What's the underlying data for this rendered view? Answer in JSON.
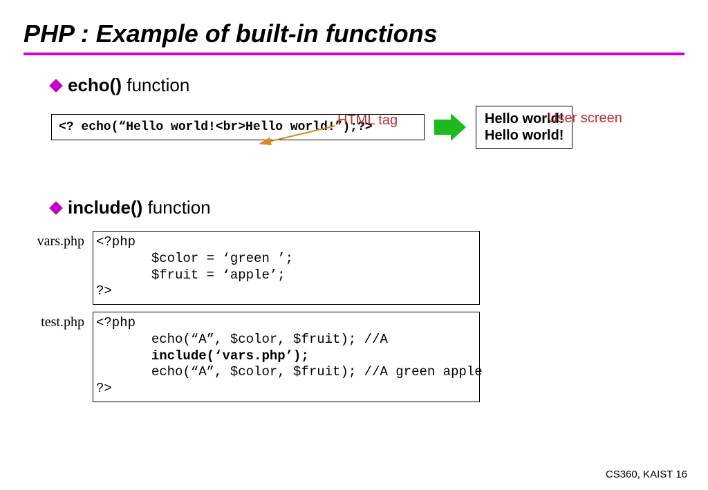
{
  "title": "PHP : Example of built-in functions",
  "section1": {
    "bullet_bold": "echo()",
    "bullet_rest": " function",
    "html_tag_label": "HTML tag",
    "user_screen_label": "User screen",
    "code": "<? echo(“Hello world!<br>Hello world!”);?>",
    "output_line1": "Hello world!",
    "output_line2": "Hello world!"
  },
  "section2": {
    "bullet_bold": "include()",
    "bullet_rest": " function",
    "files": [
      {
        "name": "vars.php",
        "code": "<?php\n       $color = ‘green ’;\n       $fruit = ‘apple’;\n?>"
      },
      {
        "name": "test.php",
        "code": "<?php\n       echo(“A”, $color, $fruit); //A\n       include(‘vars.php’);\n       echo(“A”, $color, $fruit); //A green apple\n?>",
        "bold_line": "include(‘vars.php’);"
      }
    ]
  },
  "footer": {
    "course": "CS360, KAIST",
    "page": "16"
  }
}
